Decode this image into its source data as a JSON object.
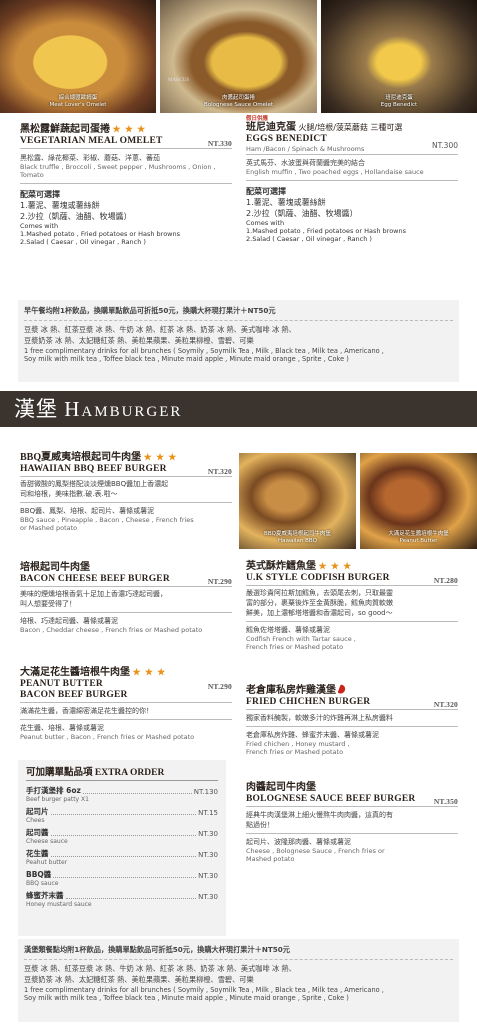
{
  "photos": [
    {
      "zh": "綜合總匯歐姆蛋",
      "en": "Meat Lover's Omelet",
      "bg": "#b47a3e"
    },
    {
      "zh": "肉醬起司蛋捲",
      "en": "Bolognese Sauce Omelet",
      "bg": "#a9823d",
      "brand": "MARCUS"
    },
    {
      "zh": "班尼迪克蛋",
      "en": "Egg Benedict",
      "bg": "#5d4833"
    },
    {
      "zh": "BBQ夏威夷培根起司牛肉堡",
      "en": "Hawaiian BBQ",
      "bg": "#7a5027"
    },
    {
      "zh": "大滿足花生醬培根牛肉堡",
      "en": "Peanut Butter",
      "bg": "#6b3f25"
    }
  ],
  "brunch_left": {
    "title_zh": "黑松露鮮蔬起司蛋捲",
    "stars": "★ ★ ★",
    "title_en": "Vegetarian Meal Omelet",
    "price": "NT.330",
    "desc_zh": "黑松露、綠花椰菜、彩椒、蘑菇、洋蔥、蕃茄",
    "desc_en": "Black truffle , Broccoli , Sweet pepper , Mushrooms , Onion , Tomato",
    "side_title": "配菜可選擇",
    "side1": "1.薯泥、薯塊或薯絲餅",
    "side2": "2.沙拉（凱薩、油醋、牧場醬）",
    "en1": "Comes with",
    "en2": "1.Mashed potato , Fried potatoes or Hash browns",
    "en3": "2.Salad ( Caesar , Oil vinegar , Ranch )"
  },
  "brunch_right": {
    "tag": "假日供應",
    "title_zh": "班尼迪克蛋",
    "title_zh2": "火腿/培根/菠菜蘑菇 三種可選",
    "title_en": "Eggs Benedict",
    "price": "NT.300",
    "opts_en": "Ham /Bacon / Spinach & Mushrooms",
    "desc_zh": "英式馬芬、水波蛋與荷蘭醬完美的結合",
    "desc_en": "English muffin , Two poached eggs , Hollandaise sauce",
    "side_title": "配菜可選擇",
    "side1": "1.薯泥、薯塊或薯絲餅",
    "side2": "2.沙拉（凱薩、油醋、牧場醬）",
    "en1": "Comes with",
    "en2": "1.Mashed potato , Fried potatoes or Hash browns",
    "en3": "2.Salad ( Caesar , Oil vinegar , Ranch )"
  },
  "brunch_note": {
    "head": "早午餐均附1杯飲品，換購單點飲品可折抵50元，換購大杯現打果汁＋NT50元",
    "line1": "豆漿 冰 熱、紅茶豆漿 冰 熱、牛奶 冰 熱、紅茶 冰 熱、奶茶 冰 熱、美式咖啡 冰 熱、",
    "line2": "豆漿奶茶 冰 熱、太妃糖紅茶 熱、美粒果蘋果、美粒果柳橙、雪碧、可樂",
    "en1": "1 free complimentary drinks for all brunches ( Soymily , Soymilk Tea , Milk , Black tea , Milk tea , Americano ,",
    "en2": "Soy milk with milk tea , Toffee black tea , Minute maid apple , Minute maid orange , Sprite , Coke )"
  },
  "section": {
    "zh": "漢堡",
    "en": "Hamburger"
  },
  "bbq": {
    "title_zh": "BBQ夏威夷培根起司牛肉堡",
    "stars": "★ ★ ★",
    "title_en": "Hawaiian BBQ Beef Burger",
    "price": "NT.320",
    "desc1": "香甜微酸的鳳梨搭配淡淡煙燻BBQ醬加上香濃起",
    "desc2": "司和培根，美味指數.破.表.啦～",
    "ing_zh": "BBQ醬、鳳梨、培根、起司片、薯條或薯泥",
    "ing_en1": "BBQ sauce , Pineapple , Bacon , Cheese , French fries",
    "ing_en2": "or Mashed potato"
  },
  "bacon": {
    "title_zh": "培根起司牛肉堡",
    "title_en": "Bacon Cheese Beef Burger",
    "price": "NT.290",
    "desc1": "美味的煙燻培根香氣十足加上香濃巧達起司醬，",
    "desc2": "叫人想要受得了！",
    "ing_zh": "培根、巧達起司醬、薯條或薯泥",
    "ing_en": "Bacon , Cheddar cheese , French fries or Mashed potato"
  },
  "peanut": {
    "title_zh": "大滿足花生醬培根牛肉堡",
    "stars": "★ ★ ★",
    "title_en1": "Peanut Butter",
    "title_en2": "Bacon Beef Burger",
    "price": "NT.290",
    "desc1": "滿滿花生醬，香濃綿密滿足花生醬控的你！",
    "ing_zh": "花生醬、培根、薯條或薯泥",
    "ing_en": "Peanut butter , Bacon , French fries or Mashed potato"
  },
  "extra": {
    "title_zh": "可加購單點品項",
    "title_en": "Extra Order",
    "items": [
      {
        "zh": "手打漢堡排 6oz",
        "en": "Beef burger patty X1",
        "price": "NT.130"
      },
      {
        "zh": "起司片",
        "en": "Chees",
        "price": "NT.15"
      },
      {
        "zh": "起司醬",
        "en": "Cheese sauce",
        "price": "NT.30"
      },
      {
        "zh": "花生醬",
        "en": "Peahut butter",
        "price": "NT.30"
      },
      {
        "zh": "BBQ醬",
        "en": "BBQ sauce",
        "price": "NT.30"
      },
      {
        "zh": "蜂蜜芥末醬",
        "en": "Honey mustard sauce",
        "price": "NT.30"
      }
    ]
  },
  "codfish": {
    "title_zh": "英式酥炸鱈魚堡",
    "stars": "★ ★ ★",
    "title_en": "U.K Style Codfish Burger",
    "price": "NT.280",
    "desc1": "嚴選珍貴阿拉斯加鱈魚，去頭尾去刺，只取最靈",
    "desc2": "富的部分，裹粟後炸至金黃酥脆，鱈魚肉質軟嫩",
    "desc3": "鮮美，加上濃郁塔塔醬和香濃起司，so good～",
    "ing_zh": "鱈魚佐塔塔醬、薯條或薯泥",
    "ing_en1": "Codfish French with Tartar sauce ,",
    "ing_en2": "French fries or Mashed potato"
  },
  "chicken": {
    "title_zh": "老倉庫私房炸雞漢堡",
    "title_en": "Fried Chichen Burger",
    "price": "NT.320",
    "desc1": "獨家香料醃製，軟嫩多汁的炸雞再淋上私房醬料",
    "ing_zh": "老倉庫私房炸雞、蜂蜜芥末醬、薯條或薯泥",
    "ing_en1": "Fried chichen , Honey mustard ,",
    "ing_en2": "French fries or Mashed potato"
  },
  "bolognese": {
    "title_zh": "肉醬起司牛肉堡",
    "title_en": "Bolognese Sauce Beef Burger",
    "price": "NT.350",
    "desc1": "經典牛肉漢堡淋上細火慢熬牛肉肉醬，這真的有",
    "desc2": "點過份！",
    "ing_zh": "起司片、波隆那肉醬、薯條或薯泥",
    "ing_en1": "Cheese , Bolognese Sauce , French fries or",
    "ing_en2": "Mashed potato"
  },
  "burger_note": {
    "head": "漢堡類餐點均附1杯飲品，換購單點飲品可折抵50元，換購大杯現打果汁＋NT50元",
    "line1": "豆漿 冰 熱、紅茶豆漿 冰 熱、牛奶 冰 熱、紅茶 冰 熱、奶茶 冰 熱、美式咖啡 冰 熱、",
    "line2": "豆漿奶茶 冰 熱、太妃糖紅茶 熱、美粒果蘋果、美粒果柳橙、雪碧、可樂",
    "en1": "1 free complimentary drinks for all brunches ( Soymily , Soymilk Tea , Milk , Black tea , Milk tea , Americano ,",
    "en2": "Soy milk with milk tea , Toffee black tea , Minute maid apple , Minute maid orange , Sprite , Coke )"
  }
}
